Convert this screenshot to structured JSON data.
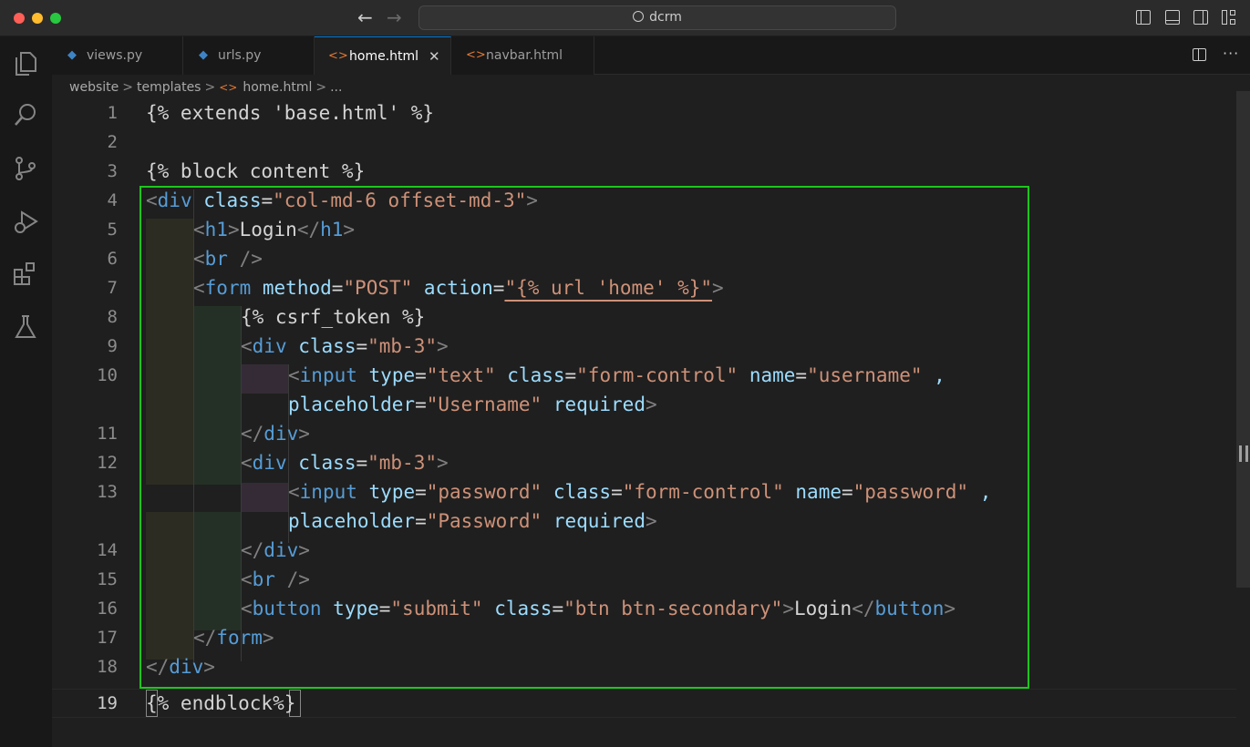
{
  "window": {
    "search_text": "dcrm"
  },
  "tabs": [
    {
      "label": "views.py",
      "icon": "python-icon",
      "active": false
    },
    {
      "label": "urls.py",
      "icon": "python-icon",
      "active": false
    },
    {
      "label": "home.html",
      "icon": "html-icon",
      "active": true,
      "close": "✕"
    },
    {
      "label": "navbar.html",
      "icon": "html-icon",
      "active": false
    }
  ],
  "breadcrumb": {
    "parts": [
      "website",
      "templates",
      "home.html",
      "..."
    ],
    "sep": ">"
  },
  "editor": {
    "current_line": 19,
    "line_numbers": [
      "1",
      "2",
      "3",
      "4",
      "5",
      "6",
      "7",
      "8",
      "9",
      "10",
      "11",
      "12",
      "13",
      "14",
      "15",
      "16",
      "17",
      "18",
      "19"
    ]
  },
  "code": {
    "l1": [
      "{% extends 'base.html' %}"
    ],
    "l3": [
      "{% block content %}"
    ],
    "l4": [
      "<",
      "div",
      " ",
      "class",
      "=",
      "\"col-md-6 offset-md-3\"",
      ">"
    ],
    "l5": [
      "<",
      "h1",
      ">",
      "Login",
      "</",
      "h1",
      ">"
    ],
    "l6": [
      "<",
      "br",
      " />"
    ],
    "l7": [
      "<",
      "form",
      " ",
      "method",
      "=",
      "\"POST\"",
      " ",
      "action",
      "=",
      "\"{% url 'home' %}\"",
      ">"
    ],
    "l8": [
      "{% csrf_token %}"
    ],
    "l9": [
      "<",
      "div",
      " ",
      "class",
      "=",
      "\"mb-3\"",
      ">"
    ],
    "l10": [
      "<",
      "input",
      " ",
      "type",
      "=",
      "\"text\"",
      " ",
      "class",
      "=",
      "\"form-control\"",
      " ",
      "name",
      "=",
      "\"username\"",
      " ,"
    ],
    "l10b": [
      "placeholder",
      "=",
      "\"Username\"",
      " ",
      "required",
      ">"
    ],
    "l11": [
      "</",
      "div",
      ">"
    ],
    "l12": [
      "<",
      "div",
      " ",
      "class",
      "=",
      "\"mb-3\"",
      ">"
    ],
    "l13": [
      "<",
      "input",
      " ",
      "type",
      "=",
      "\"password\"",
      " ",
      "class",
      "=",
      "\"form-control\"",
      " ",
      "name",
      "=",
      "\"password\"",
      " ,"
    ],
    "l13b": [
      "placeholder",
      "=",
      "\"Password\"",
      " ",
      "required",
      ">"
    ],
    "l14": [
      "</",
      "div",
      ">"
    ],
    "l15": [
      "<",
      "br",
      " />"
    ],
    "l16": [
      "<",
      "button",
      " ",
      "type",
      "=",
      "\"submit\"",
      " ",
      "class",
      "=",
      "\"btn btn-secondary\"",
      ">",
      "Login",
      "</",
      "button",
      ">"
    ],
    "l17": [
      "</",
      "form",
      ">"
    ],
    "l18": [
      "</",
      "div",
      ">"
    ],
    "l19": [
      "{% endblock%}"
    ]
  },
  "colors": {
    "highlight_box": "#1ec51e",
    "tag": "#569cd6",
    "attribute": "#9cdcfe",
    "string": "#ce9178",
    "active_tab_border": "#0078d4"
  },
  "icons": {
    "activity_bar": [
      "explorer-icon",
      "search-icon",
      "source-control-icon",
      "run-debug-icon",
      "extensions-icon",
      "testing-icon"
    ]
  }
}
